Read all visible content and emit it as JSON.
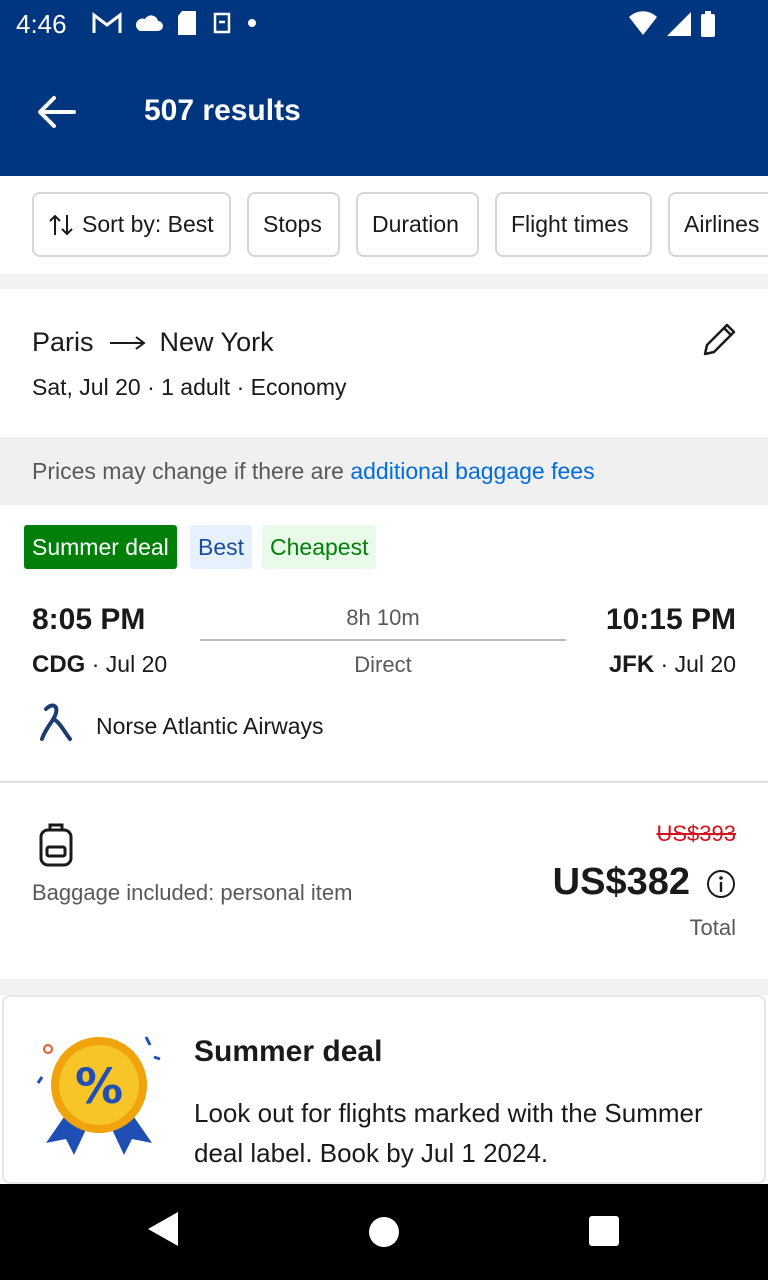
{
  "status_bar": {
    "time": "4:46",
    "left_icons": [
      "gmail-icon",
      "cloud-icon",
      "sd-card-icon",
      "sync-icon",
      "dot-icon"
    ],
    "right_icons": [
      "wifi-icon",
      "signal-icon",
      "battery-icon"
    ]
  },
  "header": {
    "title": "507 results",
    "back_icon": "arrow-back-icon"
  },
  "filters": {
    "sort_label": "Sort by: Best",
    "stops_label": "Stops",
    "duration_label": "Duration",
    "flight_times_label": "Flight times",
    "airlines_label": "Airlines"
  },
  "route": {
    "origin": "Paris",
    "destination": "New York",
    "details": "Sat, Jul 20 · 1 adult · Economy",
    "edit_icon": "pencil-icon"
  },
  "notice": {
    "text": "Prices may change if there are ",
    "link": "additional baggage fees"
  },
  "flight": {
    "badges": {
      "summer": "Summer deal",
      "best": "Best",
      "cheapest": "Cheapest"
    },
    "departure_time": "8:05 PM",
    "departure_airport": "CDG",
    "departure_date": " · Jul 20",
    "arrival_time": "10:15 PM",
    "arrival_airport": "JFK",
    "arrival_date": " · Jul 20",
    "duration": "8h 10m",
    "stops": "Direct",
    "airline": "Norse Atlantic Airways",
    "baggage": "Baggage included: personal item",
    "old_price": "US$393",
    "price": "US$382",
    "price_label": "Total"
  },
  "promo": {
    "title": "Summer deal",
    "body": "Look out for flights marked with the Summer deal label. Book by Jul 1 2024."
  },
  "colors": {
    "brand": "#003580",
    "link": "#006ce4",
    "deal_green": "#008009",
    "strike_red": "#d4111e"
  }
}
